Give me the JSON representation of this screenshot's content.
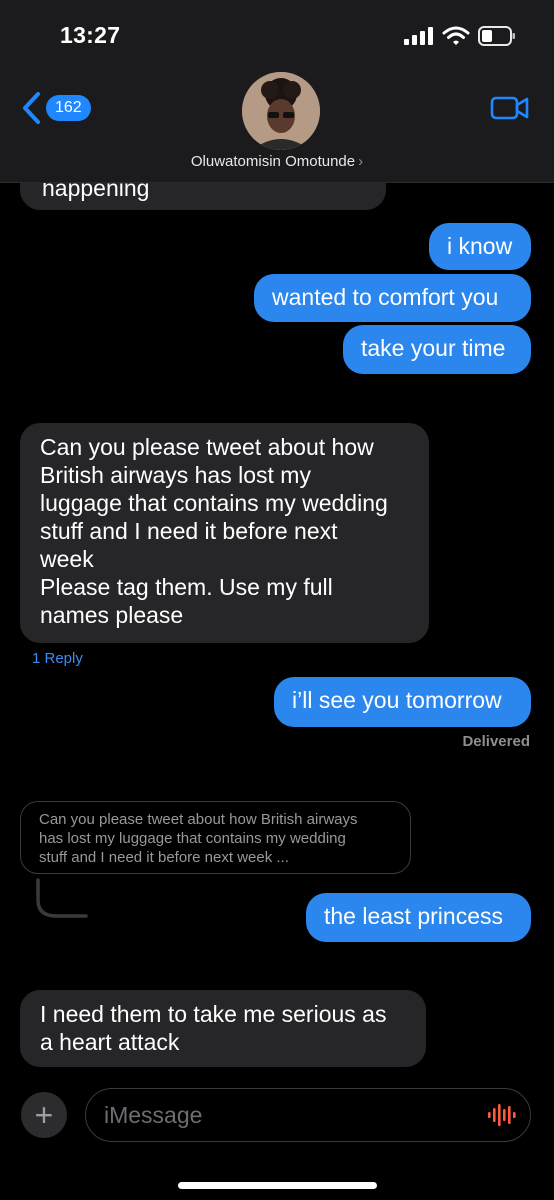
{
  "status_bar": {
    "time": "13:27"
  },
  "header": {
    "back_count": "162",
    "contact_name": "Oluwatomisin Omotunde",
    "name_chevron": "›"
  },
  "messages": {
    "top_partial": "happening",
    "sent_1": "i know",
    "sent_2": "wanted to comfort you",
    "sent_3": "take your time",
    "recv_1_lines": [
      "Can you please tweet about how",
      "British airways has lost my",
      "luggage that contains my wedding",
      "stuff and I need it before next",
      "week",
      "Please tag them. Use my full",
      "names please"
    ],
    "reply_count": "1 Reply",
    "sent_4": "i’ll see you tomorrow",
    "delivered": "Delivered",
    "quoted_lines": [
      "Can you please tweet about how British airways",
      "has lost my luggage that contains my wedding",
      "stuff and I need it before next week ..."
    ],
    "sent_5": "the least princess",
    "recv_2_lines": [
      "I need them to take me serious as",
      "a heart attack"
    ]
  },
  "input": {
    "placeholder": "iMessage",
    "plus": "+"
  },
  "colors": {
    "sent_bubble": "#2b86ee",
    "recv_bubble": "#262629",
    "accent": "#1f87ff",
    "mic": "#ff5a3c"
  },
  "icons": {
    "back": "chevron-left-icon",
    "video": "video-camera-icon",
    "signal": "cellular-signal-icon",
    "wifi": "wifi-icon",
    "battery": "battery-icon",
    "mic": "audio-waveform-icon",
    "plus": "plus-icon"
  }
}
